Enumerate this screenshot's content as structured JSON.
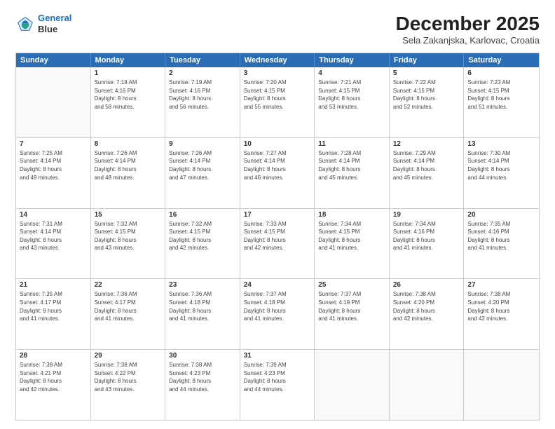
{
  "header": {
    "logo_line1": "General",
    "logo_line2": "Blue",
    "title": "December 2025",
    "subtitle": "Sela Zakanjska, Karlovac, Croatia"
  },
  "weekdays": [
    "Sunday",
    "Monday",
    "Tuesday",
    "Wednesday",
    "Thursday",
    "Friday",
    "Saturday"
  ],
  "weeks": [
    [
      {
        "day": "",
        "info": ""
      },
      {
        "day": "1",
        "info": "Sunrise: 7:18 AM\nSunset: 4:16 PM\nDaylight: 8 hours\nand 58 minutes."
      },
      {
        "day": "2",
        "info": "Sunrise: 7:19 AM\nSunset: 4:16 PM\nDaylight: 8 hours\nand 56 minutes."
      },
      {
        "day": "3",
        "info": "Sunrise: 7:20 AM\nSunset: 4:15 PM\nDaylight: 8 hours\nand 55 minutes."
      },
      {
        "day": "4",
        "info": "Sunrise: 7:21 AM\nSunset: 4:15 PM\nDaylight: 8 hours\nand 53 minutes."
      },
      {
        "day": "5",
        "info": "Sunrise: 7:22 AM\nSunset: 4:15 PM\nDaylight: 8 hours\nand 52 minutes."
      },
      {
        "day": "6",
        "info": "Sunrise: 7:23 AM\nSunset: 4:15 PM\nDaylight: 8 hours\nand 51 minutes."
      }
    ],
    [
      {
        "day": "7",
        "info": "Sunrise: 7:25 AM\nSunset: 4:14 PM\nDaylight: 8 hours\nand 49 minutes."
      },
      {
        "day": "8",
        "info": "Sunrise: 7:26 AM\nSunset: 4:14 PM\nDaylight: 8 hours\nand 48 minutes."
      },
      {
        "day": "9",
        "info": "Sunrise: 7:26 AM\nSunset: 4:14 PM\nDaylight: 8 hours\nand 47 minutes."
      },
      {
        "day": "10",
        "info": "Sunrise: 7:27 AM\nSunset: 4:14 PM\nDaylight: 8 hours\nand 46 minutes."
      },
      {
        "day": "11",
        "info": "Sunrise: 7:28 AM\nSunset: 4:14 PM\nDaylight: 8 hours\nand 45 minutes."
      },
      {
        "day": "12",
        "info": "Sunrise: 7:29 AM\nSunset: 4:14 PM\nDaylight: 8 hours\nand 45 minutes."
      },
      {
        "day": "13",
        "info": "Sunrise: 7:30 AM\nSunset: 4:14 PM\nDaylight: 8 hours\nand 44 minutes."
      }
    ],
    [
      {
        "day": "14",
        "info": "Sunrise: 7:31 AM\nSunset: 4:14 PM\nDaylight: 8 hours\nand 43 minutes."
      },
      {
        "day": "15",
        "info": "Sunrise: 7:32 AM\nSunset: 4:15 PM\nDaylight: 8 hours\nand 43 minutes."
      },
      {
        "day": "16",
        "info": "Sunrise: 7:32 AM\nSunset: 4:15 PM\nDaylight: 8 hours\nand 42 minutes."
      },
      {
        "day": "17",
        "info": "Sunrise: 7:33 AM\nSunset: 4:15 PM\nDaylight: 8 hours\nand 42 minutes."
      },
      {
        "day": "18",
        "info": "Sunrise: 7:34 AM\nSunset: 4:15 PM\nDaylight: 8 hours\nand 41 minutes."
      },
      {
        "day": "19",
        "info": "Sunrise: 7:34 AM\nSunset: 4:16 PM\nDaylight: 8 hours\nand 41 minutes."
      },
      {
        "day": "20",
        "info": "Sunrise: 7:35 AM\nSunset: 4:16 PM\nDaylight: 8 hours\nand 41 minutes."
      }
    ],
    [
      {
        "day": "21",
        "info": "Sunrise: 7:35 AM\nSunset: 4:17 PM\nDaylight: 8 hours\nand 41 minutes."
      },
      {
        "day": "22",
        "info": "Sunrise: 7:36 AM\nSunset: 4:17 PM\nDaylight: 8 hours\nand 41 minutes."
      },
      {
        "day": "23",
        "info": "Sunrise: 7:36 AM\nSunset: 4:18 PM\nDaylight: 8 hours\nand 41 minutes."
      },
      {
        "day": "24",
        "info": "Sunrise: 7:37 AM\nSunset: 4:18 PM\nDaylight: 8 hours\nand 41 minutes."
      },
      {
        "day": "25",
        "info": "Sunrise: 7:37 AM\nSunset: 4:19 PM\nDaylight: 8 hours\nand 41 minutes."
      },
      {
        "day": "26",
        "info": "Sunrise: 7:38 AM\nSunset: 4:20 PM\nDaylight: 8 hours\nand 42 minutes."
      },
      {
        "day": "27",
        "info": "Sunrise: 7:38 AM\nSunset: 4:20 PM\nDaylight: 8 hours\nand 42 minutes."
      }
    ],
    [
      {
        "day": "28",
        "info": "Sunrise: 7:38 AM\nSunset: 4:21 PM\nDaylight: 8 hours\nand 42 minutes."
      },
      {
        "day": "29",
        "info": "Sunrise: 7:38 AM\nSunset: 4:22 PM\nDaylight: 8 hours\nand 43 minutes."
      },
      {
        "day": "30",
        "info": "Sunrise: 7:38 AM\nSunset: 4:23 PM\nDaylight: 8 hours\nand 44 minutes."
      },
      {
        "day": "31",
        "info": "Sunrise: 7:39 AM\nSunset: 4:23 PM\nDaylight: 8 hours\nand 44 minutes."
      },
      {
        "day": "",
        "info": ""
      },
      {
        "day": "",
        "info": ""
      },
      {
        "day": "",
        "info": ""
      }
    ]
  ]
}
